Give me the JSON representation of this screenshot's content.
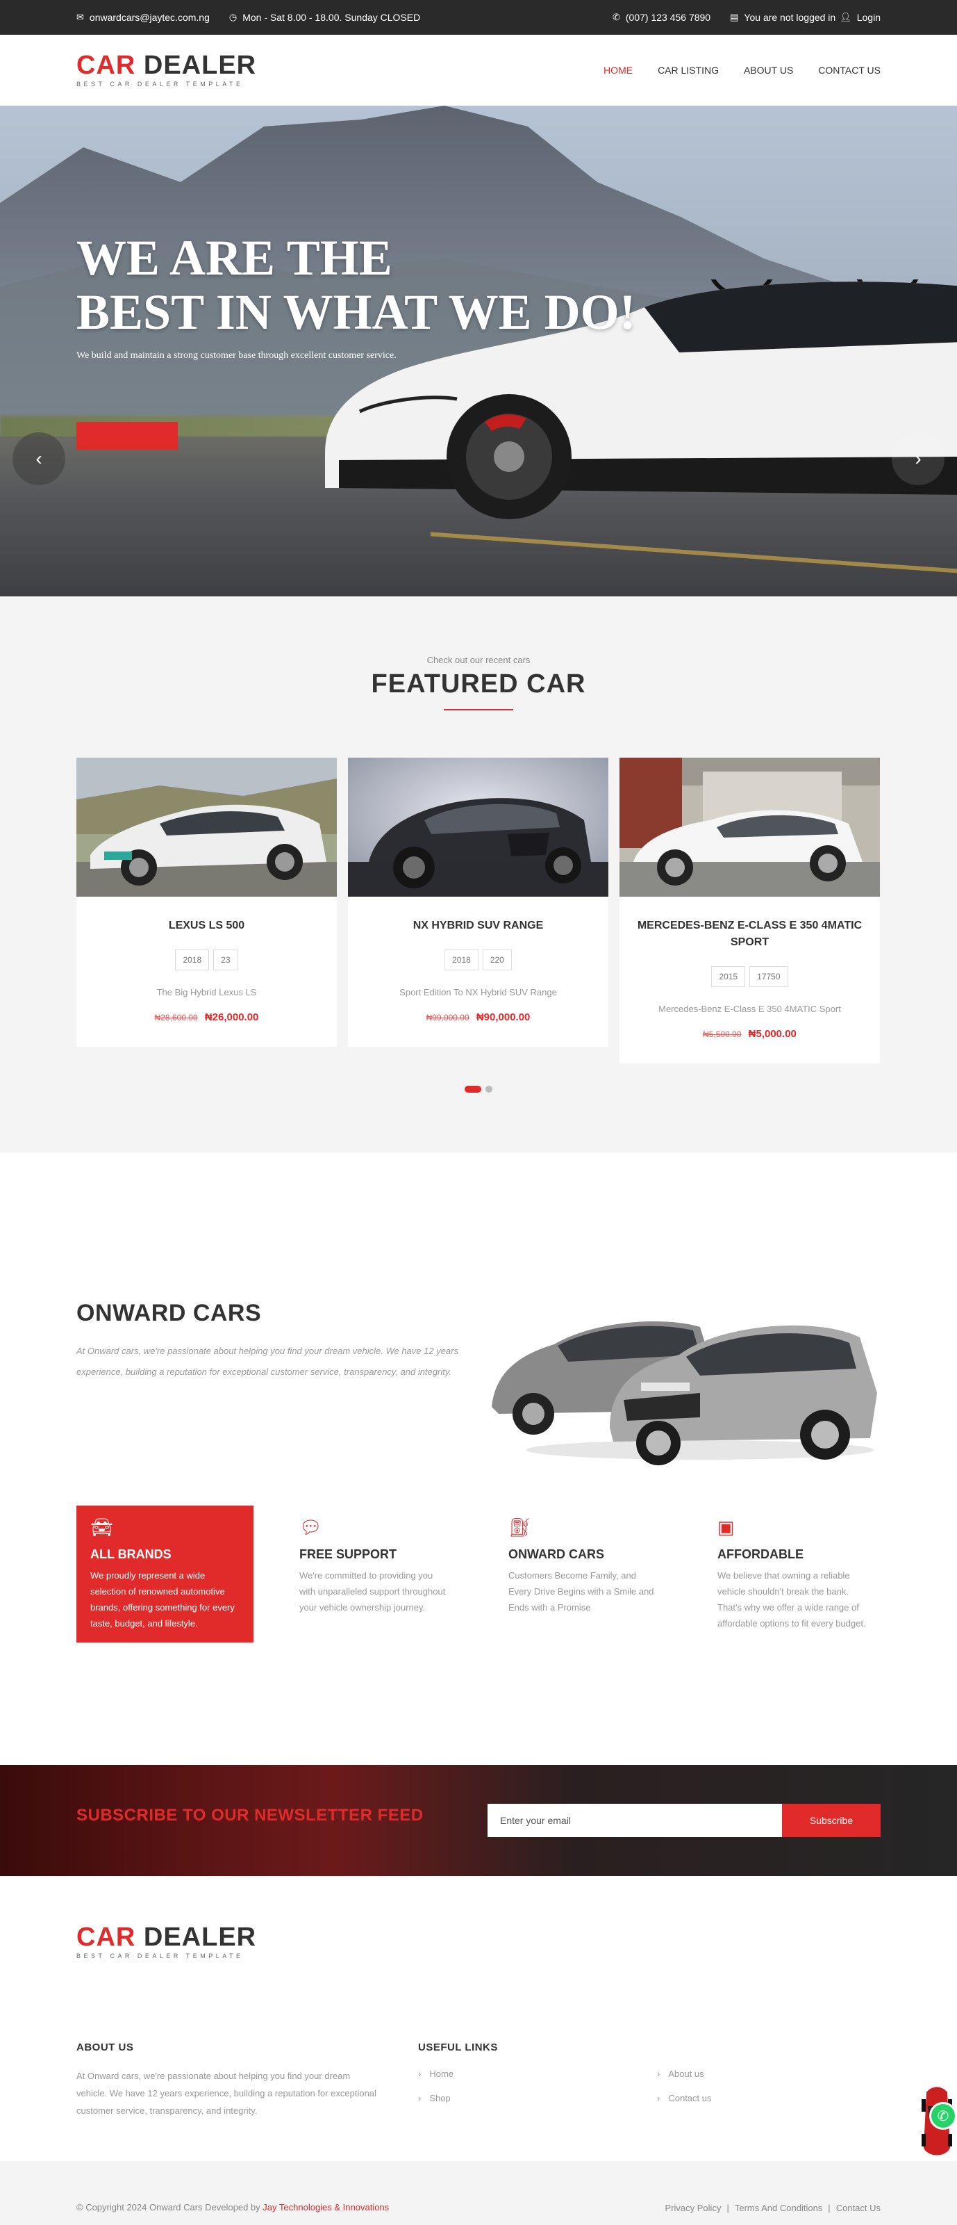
{
  "topbar": {
    "email": "onwardcars@jaytec.com.ng",
    "hours": "Mon - Sat 8.00 - 18.00. Sunday CLOSED",
    "phone": "(007) 123 456 7890",
    "login_status": "You are not logged in",
    "login_label": "Login"
  },
  "header": {
    "logo_car": "CAR",
    "logo_dealer": "DEALER",
    "logo_tagline": "BEST CAR DEALER TEMPLATE",
    "nav": [
      "HOME",
      "CAR LISTING",
      "ABOUT US",
      "CONTACT US"
    ],
    "active_nav": "HOME"
  },
  "hero": {
    "title_line1": "WE ARE THE",
    "title_line2": "BEST IN WHAT WE DO!",
    "subtitle": "We build and maintain a strong customer base through excellent customer service.",
    "prev_icon": "chevron-left-icon",
    "next_icon": "chevron-right-icon"
  },
  "featured": {
    "kicker": "Check out our recent cars",
    "title": "FEATURED CAR",
    "cars": [
      {
        "name": "LEXUS LS 500",
        "year": "2018",
        "spec2": "23",
        "desc": "The Big Hybrid Lexus LS",
        "old_price": "₦28,600.00",
        "price": "₦26,000.00"
      },
      {
        "name": "NX HYBRID SUV RANGE",
        "year": "2018",
        "spec2": "220",
        "desc": "Sport Edition To NX Hybrid SUV Range",
        "old_price": "₦99,000.00",
        "price": "₦90,000.00"
      },
      {
        "name": "MERCEDES-BENZ E-CLASS E 350 4MATIC SPORT",
        "year": "2015",
        "spec2": "17750",
        "desc": "Mercedes-Benz E-Class E 350 4MATIC Sport",
        "old_price": "₦5,500.00",
        "price": "₦5,000.00"
      }
    ],
    "active_slide": 1,
    "slide_count": 2
  },
  "about": {
    "title": "ONWARD CARS",
    "description": "At Onward cars, we're passionate about helping you find your dream vehicle. We have 12 years experience, building a reputation for exceptional customer service, transparency, and integrity.",
    "features": [
      {
        "icon": "car-front-icon",
        "title": "ALL BRANDS",
        "desc": "We proudly represent a wide selection of renowned automotive brands, offering something for every taste, budget, and lifestyle."
      },
      {
        "icon": "chat-bubble-icon",
        "title": "FREE SUPPORT",
        "desc": "We're committed to providing you with unparalleled support throughout your vehicle ownership journey."
      },
      {
        "icon": "fuel-pump-icon",
        "title": "ONWARD CARS",
        "desc": "Customers Become Family, and Every Drive Begins with a Smile and Ends with a Promise"
      },
      {
        "icon": "wallet-icon",
        "title": "AFFORDABLE",
        "desc": "We believe that owning a reliable vehicle shouldn't break the bank. That's why we offer a wide range of affordable options to fit every budget."
      }
    ]
  },
  "newsletter": {
    "title": "SUBSCRIBE TO OUR NEWSLETTER FEED",
    "placeholder": "Enter your email",
    "button": "Subscribe"
  },
  "footer": {
    "about_heading": "ABOUT US",
    "about_text": "At Onward cars, we're passionate about helping you find your dream vehicle. We have 12 years experience, building a reputation for exceptional customer service, transparency, and integrity.",
    "links_heading": "USEFUL LINKS",
    "links": [
      "Home",
      "About us",
      "Shop",
      "Contact us"
    ],
    "copyright_prefix": "© Copyright 2024 Onward Cars Developed by",
    "copyright_link": "Jay Technologies & Innovations",
    "legal": [
      "Privacy Policy",
      "Terms And Conditions",
      "Contact Us"
    ],
    "separator": "|"
  },
  "colors": {
    "accent": "#e12a2a",
    "topbar": "#2a2a2a",
    "section_bg": "#f4f4f4",
    "whatsapp": "#25d366"
  }
}
